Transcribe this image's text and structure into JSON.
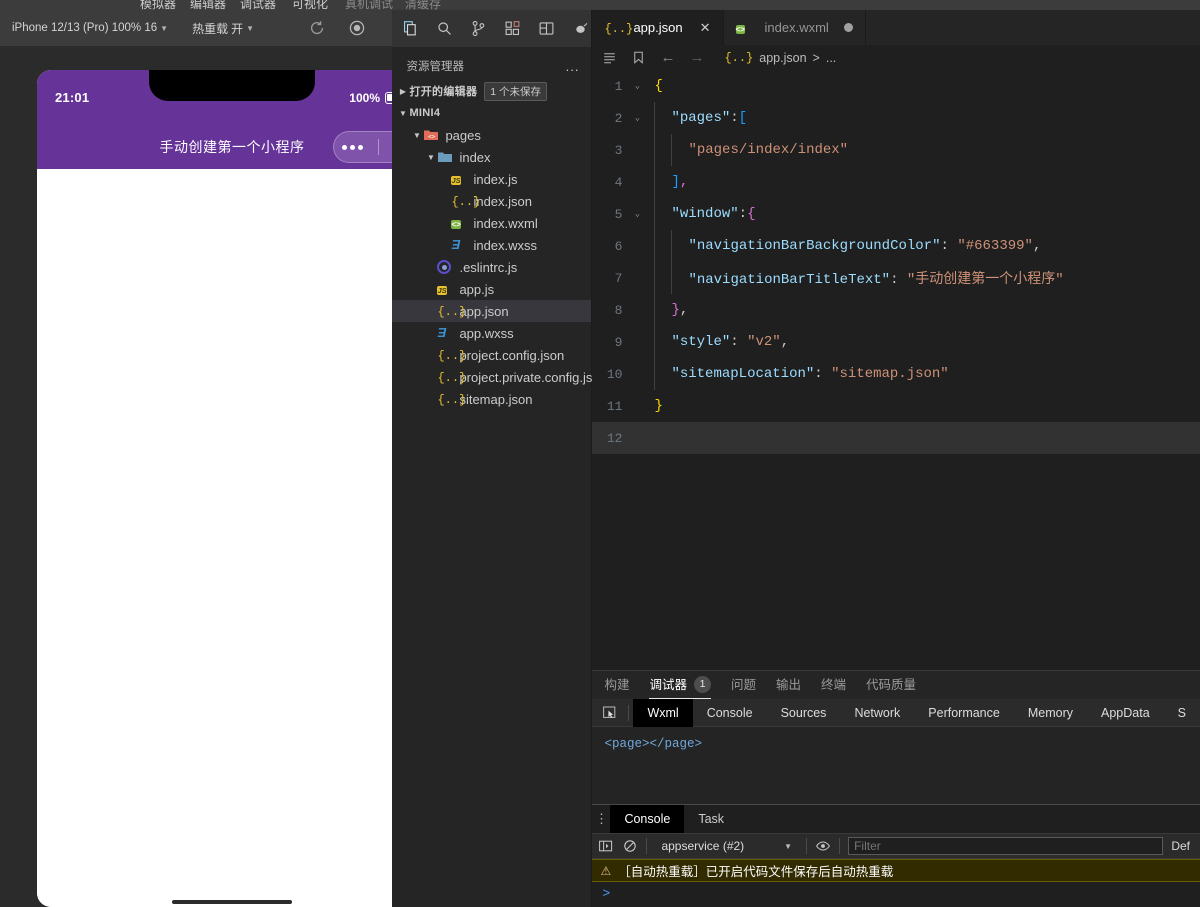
{
  "menu_strip": {
    "items": [
      "模拟器",
      "编辑器",
      "调试器",
      "可视化"
    ],
    "dim_items": [
      "真机调试",
      "清缓存"
    ]
  },
  "simulator": {
    "device_select": "iPhone 12/13 (Pro) 100% 16",
    "hot_reload_label": "热重载",
    "hot_reload_value": "开",
    "toolbar_icons": [
      "refresh-icon",
      "record-icon",
      "device-icon",
      "multiscreen-icon"
    ],
    "status_bar": {
      "time": "21:01",
      "battery_percent": "100%"
    },
    "nav_bar": {
      "title": "手动创建第一个小程序",
      "background_color": "#663399"
    }
  },
  "activity_bar": {
    "icons": [
      "explorer-icon",
      "search-icon",
      "source-control-icon",
      "extensions-icon",
      "layout-icon",
      "debug-icon"
    ]
  },
  "sidebar": {
    "title": "资源管理器",
    "more_label": "...",
    "open_editors": {
      "label": "打开的编辑器",
      "badge": "1 个未保存"
    },
    "project_name": "MINI4",
    "tree": [
      {
        "label": "pages",
        "icon": "folder-red-icon",
        "indent": 1,
        "expanded": true,
        "selected": false
      },
      {
        "label": "index",
        "icon": "folder-blue-icon",
        "indent": 2,
        "expanded": true,
        "selected": false
      },
      {
        "label": "index.js",
        "icon": "js-icon",
        "indent": 3,
        "expanded": null,
        "selected": false
      },
      {
        "label": "index.json",
        "icon": "json-icon",
        "indent": 3,
        "expanded": null,
        "selected": false
      },
      {
        "label": "index.wxml",
        "icon": "wxml-icon",
        "indent": 3,
        "expanded": null,
        "selected": false
      },
      {
        "label": "index.wxss",
        "icon": "wxss-icon",
        "indent": 3,
        "expanded": null,
        "selected": false
      },
      {
        "label": ".eslintrc.js",
        "icon": "eslint-icon",
        "indent": 2,
        "expanded": null,
        "selected": false
      },
      {
        "label": "app.js",
        "icon": "js-icon",
        "indent": 2,
        "expanded": null,
        "selected": false
      },
      {
        "label": "app.json",
        "icon": "json-icon",
        "indent": 2,
        "expanded": null,
        "selected": true
      },
      {
        "label": "app.wxss",
        "icon": "wxss-icon",
        "indent": 2,
        "expanded": null,
        "selected": false
      },
      {
        "label": "project.config.json",
        "icon": "json-icon",
        "indent": 2,
        "expanded": null,
        "selected": false
      },
      {
        "label": "project.private.config.js...",
        "icon": "json-icon",
        "indent": 2,
        "expanded": null,
        "selected": false
      },
      {
        "label": "sitemap.json",
        "icon": "json-icon",
        "indent": 2,
        "expanded": null,
        "selected": false
      }
    ]
  },
  "editor": {
    "tabs": [
      {
        "label": "app.json",
        "icon": "json-icon",
        "active": true,
        "dirty": false
      },
      {
        "label": "index.wxml",
        "icon": "wxml-icon",
        "active": false,
        "dirty": true
      }
    ],
    "breadcrumb": {
      "file": "app.json",
      "separator": ">",
      "tail": "..."
    },
    "lines": [
      {
        "n": "1",
        "indent": 0,
        "fold": "v",
        "tokens": [
          {
            "t": "{",
            "c": "k-brace-y"
          }
        ]
      },
      {
        "n": "2",
        "indent": 1,
        "fold": "v",
        "tokens": [
          {
            "t": "\"pages\"",
            "c": "k-key"
          },
          {
            "t": ":",
            "c": "k-punc"
          },
          {
            "t": "[",
            "c": "k-brace-b"
          }
        ]
      },
      {
        "n": "3",
        "indent": 2,
        "fold": "",
        "tokens": [
          {
            "t": "\"pages/index/index\"",
            "c": "k-str"
          }
        ]
      },
      {
        "n": "4",
        "indent": 1,
        "fold": "",
        "tokens": [
          {
            "t": "]",
            "c": "k-brace-b"
          },
          {
            "t": ",",
            "c": "k-brace-p"
          }
        ]
      },
      {
        "n": "5",
        "indent": 1,
        "fold": "v",
        "tokens": [
          {
            "t": "\"window\"",
            "c": "k-key"
          },
          {
            "t": ":",
            "c": "k-punc"
          },
          {
            "t": "{",
            "c": "k-brace-p"
          }
        ]
      },
      {
        "n": "6",
        "indent": 2,
        "fold": "",
        "tokens": [
          {
            "t": "\"navigationBarBackgroundColor\"",
            "c": "k-key"
          },
          {
            "t": ": ",
            "c": "k-punc"
          },
          {
            "t": "\"#663399\"",
            "c": "k-str"
          },
          {
            "t": ",",
            "c": "k-punc"
          }
        ]
      },
      {
        "n": "7",
        "indent": 2,
        "fold": "",
        "tokens": [
          {
            "t": "\"navigationBarTitleText\"",
            "c": "k-key"
          },
          {
            "t": ": ",
            "c": "k-punc"
          },
          {
            "t": "\"手动创建第一个小程序\"",
            "c": "k-str"
          }
        ]
      },
      {
        "n": "8",
        "indent": 1,
        "fold": "",
        "tokens": [
          {
            "t": "}",
            "c": "k-brace-p"
          },
          {
            "t": ",",
            "c": "k-punc"
          }
        ]
      },
      {
        "n": "9",
        "indent": 1,
        "fold": "",
        "tokens": [
          {
            "t": "\"style\"",
            "c": "k-key"
          },
          {
            "t": ": ",
            "c": "k-punc"
          },
          {
            "t": "\"v2\"",
            "c": "k-str"
          },
          {
            "t": ",",
            "c": "k-punc"
          }
        ]
      },
      {
        "n": "10",
        "indent": 1,
        "fold": "",
        "tokens": [
          {
            "t": "\"sitemapLocation\"",
            "c": "k-key"
          },
          {
            "t": ": ",
            "c": "k-punc"
          },
          {
            "t": "\"sitemap.json\"",
            "c": "k-str"
          }
        ]
      },
      {
        "n": "11",
        "indent": 0,
        "fold": "",
        "tokens": [
          {
            "t": "}",
            "c": "k-brace-y"
          }
        ]
      },
      {
        "n": "12",
        "indent": 0,
        "fold": "",
        "tokens": [],
        "current": true
      }
    ]
  },
  "panel": {
    "tabs": [
      {
        "label": "构建",
        "active": false,
        "badge": null
      },
      {
        "label": "调试器",
        "active": true,
        "badge": "1"
      },
      {
        "label": "问题",
        "active": false,
        "badge": null
      },
      {
        "label": "输出",
        "active": false,
        "badge": null
      },
      {
        "label": "终端",
        "active": false,
        "badge": null
      },
      {
        "label": "代码质量",
        "active": false,
        "badge": null
      }
    ],
    "devtools_tabs": [
      {
        "label": "Wxml",
        "active": true
      },
      {
        "label": "Console",
        "active": false
      },
      {
        "label": "Sources",
        "active": false
      },
      {
        "label": "Network",
        "active": false
      },
      {
        "label": "Performance",
        "active": false
      },
      {
        "label": "Memory",
        "active": false
      },
      {
        "label": "AppData",
        "active": false
      },
      {
        "label": "S",
        "active": false
      }
    ],
    "wxml_content": "<page></page>"
  },
  "console": {
    "tabs": [
      {
        "label": "Console",
        "active": true
      },
      {
        "label": "Task",
        "active": false
      }
    ],
    "context": "appservice (#2)",
    "filter_placeholder": "Filter",
    "levels_label": "Def",
    "messages": [
      {
        "type": "warning",
        "text": "［自动热重载］已开启代码文件保存后自动热重载"
      }
    ],
    "prompt": ">"
  }
}
